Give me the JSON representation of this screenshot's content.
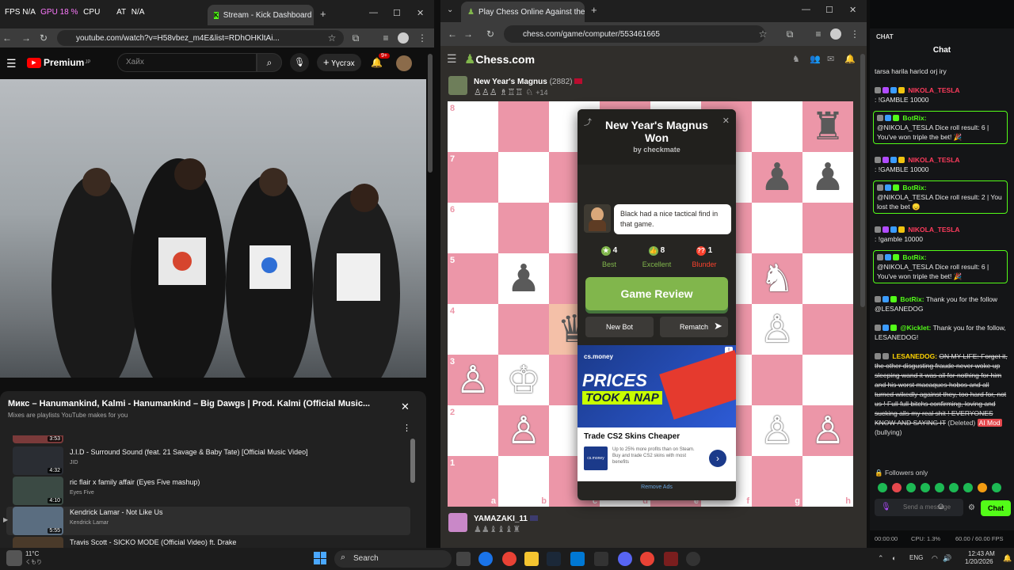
{
  "overlay": {
    "fps": "FPS N/A",
    "gpu": "GPU 18 %",
    "cpu": "CPU",
    "extra1": "AT",
    "extra2": "N/A"
  },
  "yt_browser": {
    "tabs": [
      {
        "label": "Stream - Kick Dashboard"
      }
    ],
    "url": "youtube.com/watch?v=H58vbez_m4E&list=RDhOHKltAi...",
    "logo_label": "Premium",
    "logo_sup": "JP",
    "search_placeholder": "Хайх",
    "create_label": "Үүсгэх",
    "notif_count": "9+",
    "mix_title": "Микс – Hanumankind, Kalmi - Hanumankind – Big Dawgs | Prod. Kalmi (Official Music...",
    "mix_subtitle": "Mixes are playlists YouTube makes for you",
    "playlist": [
      {
        "duration": "3:53",
        "title": "",
        "channel": ""
      },
      {
        "duration": "4:32",
        "title": "J.I.D - Surround Sound (feat. 21 Savage & Baby Tate) [Official Music Video]",
        "channel": "JID"
      },
      {
        "duration": "4:10",
        "title": "ric flair x family affair (Eyes Five mashup)",
        "channel": "Eyes Five"
      },
      {
        "duration": "5:55",
        "title": "Kendrick Lamar - Not Like Us",
        "channel": "Kendrick Lamar"
      },
      {
        "duration": "",
        "title": "Travis Scott - SICKO MODE (Official Video) ft. Drake",
        "channel": ""
      }
    ]
  },
  "chess_browser": {
    "tab_label": "Play Chess Online Against the C",
    "url": "chess.com/game/computer/553461665",
    "logo_text": "Chess.com",
    "top_player": {
      "name": "New Year's Magnus",
      "rating": "(2882)",
      "captured_extra": "+14"
    },
    "bottom_player": {
      "name": "YAMAZAKI_11"
    },
    "ranks": [
      "8",
      "7",
      "6",
      "5",
      "4",
      "3",
      "2",
      "1"
    ],
    "files": [
      "a",
      "b",
      "c",
      "d",
      "e",
      "f",
      "g",
      "h"
    ],
    "modal": {
      "title": "New Year's Magnus Won",
      "subtitle": "by checkmate",
      "coach_text": "Black had a nice tactical find in that game.",
      "stats": [
        {
          "count": "4",
          "label": "Best",
          "color": "#81b64c"
        },
        {
          "count": "8",
          "label": "Excellent",
          "color": "#81b64c"
        },
        {
          "count": "1",
          "label": "Blunder",
          "color": "#fa412d"
        }
      ],
      "review_label": "Game Review",
      "new_bot_label": "New Bot",
      "rematch_label": "Rematch",
      "ad_brand": "cs.money",
      "ad_headline1": "PRICES",
      "ad_headline2": "TOOK A NAP",
      "ad_title": "Trade CS2 Skins Cheaper",
      "ad_body": "Up to 25% more profits than on Steam. Buy and trade CS2 skins with most benefits",
      "remove_ads": "Remove Ads"
    }
  },
  "chat": {
    "header": "CHAT",
    "title": "Chat",
    "messages": [
      {
        "user": "",
        "text": "tarsa harila haricd orj iry",
        "bot": false
      },
      {
        "user": "NIKOLA_TESLA",
        "text": ": !GAMBLE 10000",
        "bot": false,
        "color": "#ff3b5c"
      },
      {
        "user": "BotRix:",
        "text": "@NIKOLA_TESLA Dice roll result: 6 | You've won triple the bet! 🎉",
        "bot": true,
        "color": "#53fc18"
      },
      {
        "user": "NIKOLA_TESLA",
        "text": ": !GAMBLE 10000",
        "bot": false,
        "color": "#ff3b5c"
      },
      {
        "user": "BotRix:",
        "text": "@NIKOLA_TESLA Dice roll result: 2 | You lost the bet 😞",
        "bot": true,
        "color": "#53fc18"
      },
      {
        "user": "NIKOLA_TESLA",
        "text": ": !gamble 10000",
        "bot": false,
        "color": "#ff3b5c"
      },
      {
        "user": "BotRix:",
        "text": "@NIKOLA_TESLA Dice roll result: 6 | You've won triple the bet! 🎉",
        "bot": true,
        "color": "#53fc18"
      },
      {
        "user": "BotRix:",
        "text": "Thank you for the follow @LESANEDOG",
        "bot": false,
        "color": "#53fc18"
      },
      {
        "user": "@Kicklet:",
        "text": "Thank you for the follow, LESANEDOG!",
        "bot": false,
        "color": "#53fc18"
      },
      {
        "user": "LESANEDOG:",
        "text": "ON MY LIFE: Forget it, the other disgusting fraude never woke up sleeping wand it was all for nothing for him and his worst macaques hobos and all turned wikedly against they, too hard for, not us ! Full full bitchs confirming, loving and sucking alls my real shit ! EVERYONES KNOW AND SAYING IT",
        "bot": false,
        "color": "#ffd400",
        "deleted": "(Deleted)",
        "tag": "AI Mod",
        "tag_note": "(bullying)"
      }
    ],
    "followers_only": "Followers only",
    "send_placeholder": "Send a message",
    "chat_button": "Chat",
    "stats_time": "00:00:00",
    "stats_cpu": "CPU: 1.3%",
    "stats_fps": "60.00 / 60.00 FPS"
  },
  "taskbar": {
    "weather_temp": "11°C",
    "weather_desc": "くもり",
    "search_label": "Search",
    "lang": "ENG",
    "time": "12:43 AM",
    "date": "1/20/2026"
  }
}
